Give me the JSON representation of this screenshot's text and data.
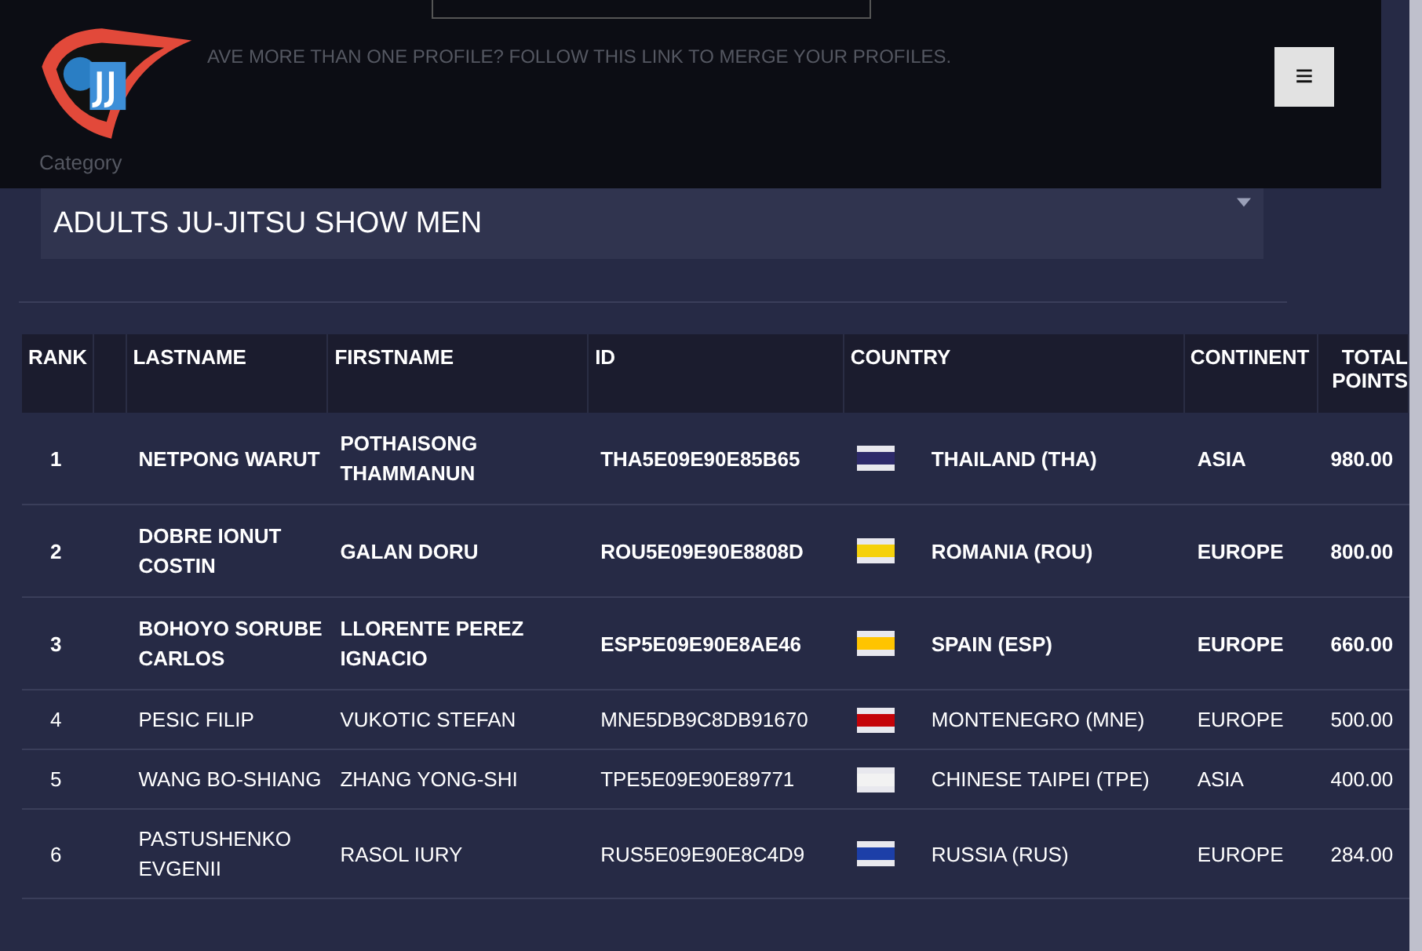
{
  "merge_link": "AVE MORE THAN ONE PROFILE? FOLLOW THIS LINK TO MERGE YOUR PROFILES.",
  "menu_button": "≡",
  "category": {
    "label": "Category",
    "value": "ADULTS JU-JITSU SHOW MEN"
  },
  "table": {
    "columns": [
      "RANK",
      "",
      "LASTNAME",
      "FIRSTNAME",
      "ID",
      "COUNTRY",
      "CONTINENT",
      "TOTAL POINTS"
    ],
    "rows": [
      {
        "rank": "1",
        "lastname": "NETPONG WARUT",
        "firstname": "POTHAISONG THAMMANUN",
        "id": "THA5E09E90E85B65",
        "color": "#2d2a6a",
        "country": "THAILAND (THA)",
        "continent": "ASIA",
        "points": "980.00",
        "highlighted": true
      },
      {
        "rank": "2",
        "lastname": "DOBRE IONUT COSTIN",
        "firstname": "GALAN DORU",
        "id": "ROU5E09E90E8808D",
        "color": "#f5d10a",
        "country": "ROMANIA (ROU)",
        "continent": "EUROPE",
        "points": "800.00",
        "highlighted": true
      },
      {
        "rank": "3",
        "lastname": "BOHOYO SORUBE CARLOS",
        "firstname": "LLORENTE PEREZ IGNACIO",
        "id": "ESP5E09E90E8AE46",
        "color": "#ffc400",
        "country": "SPAIN (ESP)",
        "continent": "EUROPE",
        "points": "660.00",
        "highlighted": true
      },
      {
        "rank": "4",
        "lastname": "PESIC FILIP",
        "firstname": "VUKOTIC STEFAN",
        "id": "MNE5DB9C8DB91670",
        "color": "#c40308",
        "country": "MONTENEGRO (MNE)",
        "continent": "EUROPE",
        "points": "500.00",
        "highlighted": false
      },
      {
        "rank": "5",
        "lastname": "WANG BO-SHIANG",
        "firstname": "ZHANG YONG-SHI",
        "id": "TPE5E09E90E89771",
        "color": "#f2f2f2",
        "country": "CHINESE TAIPEI (TPE)",
        "continent": "ASIA",
        "points": "400.00",
        "highlighted": false
      },
      {
        "rank": "6",
        "lastname": "PASTUSHENKO EVGENII",
        "firstname": "RASOL IURY",
        "id": "RUS5E09E90E8C4D9",
        "color": "#1c3fa8",
        "country": "RUSSIA (RUS)",
        "continent": "EUROPE",
        "points": "284.00",
        "highlighted": false
      }
    ]
  }
}
